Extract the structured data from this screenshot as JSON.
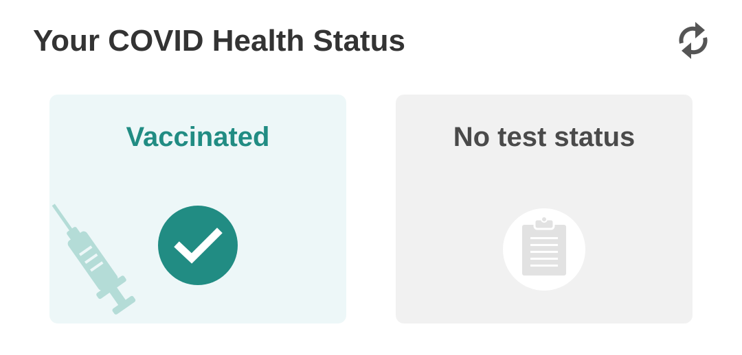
{
  "header": {
    "title": "Your COVID Health Status",
    "refresh_icon": "refresh-icon"
  },
  "cards": {
    "vaccination": {
      "title": "Vaccinated",
      "status_icon": "check-circle-icon",
      "decor_icon": "syringe-icon",
      "accent_color": "#218c83",
      "background_color": "#edf7f8"
    },
    "test": {
      "title": "No test status",
      "status_icon": "clipboard-icon",
      "background_color": "#f1f1f1"
    }
  }
}
